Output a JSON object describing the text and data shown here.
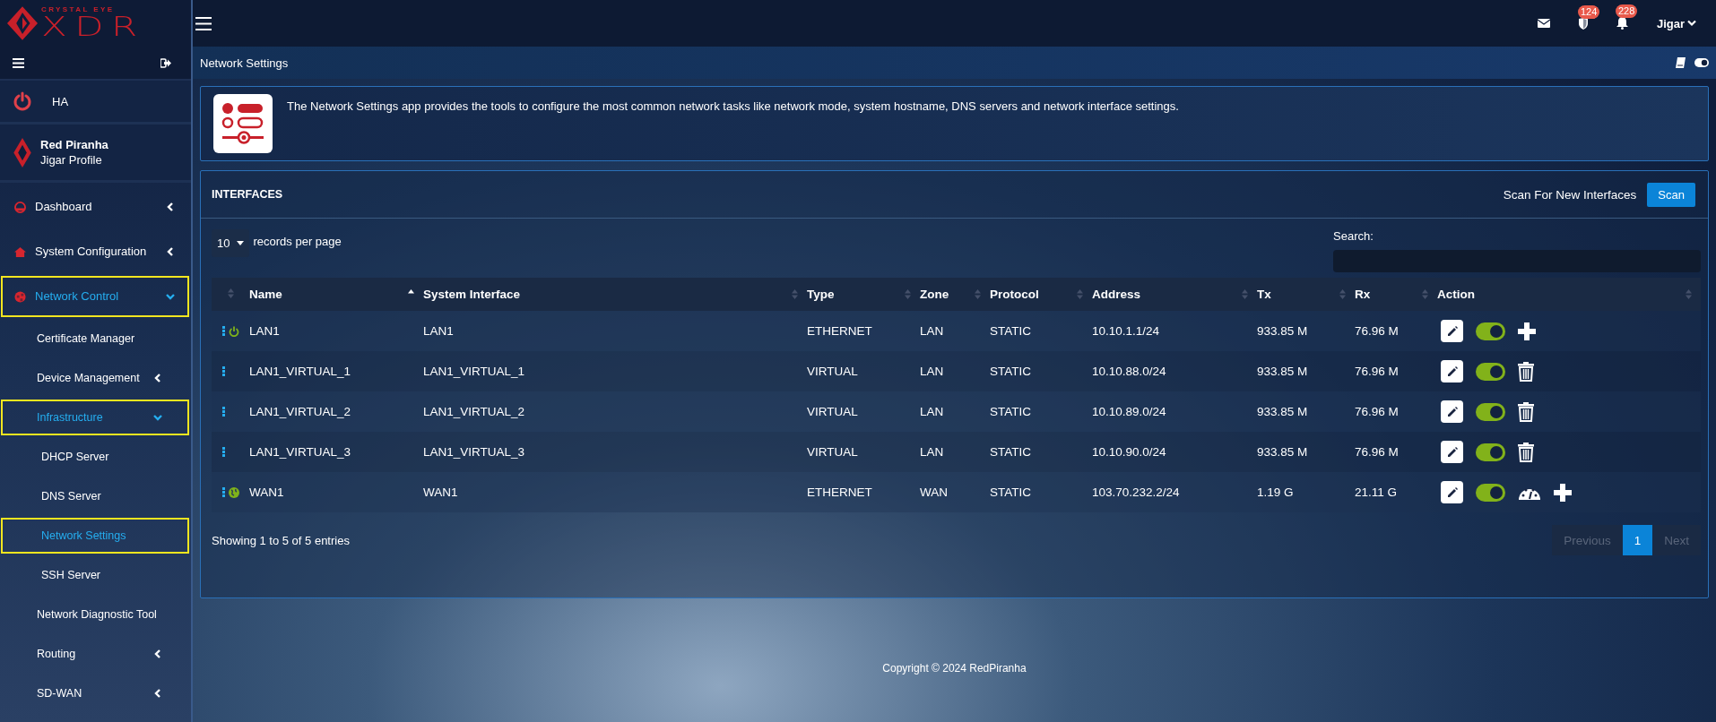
{
  "logo": {
    "tagline": "CRYSTAL EYE",
    "name": "XDR"
  },
  "topbar": {
    "badges": [
      {
        "kind": "shield",
        "count": "124"
      },
      {
        "kind": "bell",
        "count": "228"
      }
    ],
    "user": "Jigar"
  },
  "sidebar": {
    "ha": "HA",
    "profile": {
      "company": "Red Piranha",
      "name": "Jigar Profile"
    },
    "items": [
      {
        "label": "Dashboard",
        "kind": "gauge",
        "selected": false,
        "expanded": false
      },
      {
        "label": "System Configuration",
        "kind": "home",
        "selected": false,
        "expanded": false
      },
      {
        "label": "Network Control",
        "kind": "globe",
        "selected": true,
        "expanded": true,
        "children": [
          {
            "label": "Certificate Manager",
            "selected": false
          },
          {
            "label": "Device Management",
            "selected": false,
            "expanded": false
          },
          {
            "label": "Infrastructure",
            "selected": true,
            "expanded": true,
            "children": [
              {
                "label": "DHCP Server",
                "selected": false
              },
              {
                "label": "DNS Server",
                "selected": false
              },
              {
                "label": "Network Settings",
                "selected": true
              },
              {
                "label": "SSH Server",
                "selected": false
              }
            ]
          },
          {
            "label": "Network Diagnostic Tool",
            "selected": false
          },
          {
            "label": "Routing",
            "selected": false,
            "expanded": false
          },
          {
            "label": "SD-WAN",
            "selected": false,
            "expanded": false
          }
        ]
      }
    ]
  },
  "page_title": "Network Settings",
  "intro": "The Network Settings app provides the tools to configure the most common network tasks like network mode, system hostname, DNS servers and network interface settings.",
  "interfaces": {
    "title": "INTERFACES",
    "scan_label": "Scan For New Interfaces",
    "scan_button": "Scan",
    "page_size": "10",
    "page_size_label": "records per page",
    "search_label": "Search:",
    "columns": [
      {
        "label": "Name",
        "selected": true
      },
      {
        "label": "System Interface",
        "selected": false
      },
      {
        "label": "Type",
        "selected": false
      },
      {
        "label": "Zone",
        "selected": false
      },
      {
        "label": "Protocol",
        "selected": false
      },
      {
        "label": "Address",
        "selected": false
      },
      {
        "label": "Tx",
        "selected": false
      },
      {
        "label": "Rx",
        "selected": false
      },
      {
        "label": "Action",
        "selected": false
      }
    ],
    "rows": [
      {
        "kind": "power",
        "cells": [
          "LAN1",
          "LAN1",
          "ETHERNET",
          "LAN",
          "STATIC",
          "10.10.1.1/24",
          "933.85 M",
          "76.96 M"
        ],
        "on": true,
        "actions": [
          {
            "kind": "add"
          }
        ]
      },
      {
        "kind": "plain",
        "cells": [
          "LAN1_VIRTUAL_1",
          "LAN1_VIRTUAL_1",
          "VIRTUAL",
          "LAN",
          "STATIC",
          "10.10.88.0/24",
          "933.85 M",
          "76.96 M"
        ],
        "on": true,
        "actions": [
          {
            "kind": "delete"
          }
        ]
      },
      {
        "kind": "plain",
        "cells": [
          "LAN1_VIRTUAL_2",
          "LAN1_VIRTUAL_2",
          "VIRTUAL",
          "LAN",
          "STATIC",
          "10.10.89.0/24",
          "933.85 M",
          "76.96 M"
        ],
        "on": true,
        "actions": [
          {
            "kind": "delete"
          }
        ]
      },
      {
        "kind": "plain",
        "cells": [
          "LAN1_VIRTUAL_3",
          "LAN1_VIRTUAL_3",
          "VIRTUAL",
          "LAN",
          "STATIC",
          "10.10.90.0/24",
          "933.85 M",
          "76.96 M"
        ],
        "on": true,
        "actions": [
          {
            "kind": "delete"
          }
        ]
      },
      {
        "kind": "globe",
        "cells": [
          "WAN1",
          "WAN1",
          "ETHERNET",
          "WAN",
          "STATIC",
          "103.70.232.2/24",
          "1.19 G",
          "21.11 G"
        ],
        "on": true,
        "actions": [
          {
            "kind": "gauge"
          },
          {
            "kind": "add"
          }
        ]
      }
    ],
    "summary": "Showing 1 to 5 of 5 entries",
    "pagination": [
      {
        "label": "Previous",
        "disabled": true,
        "selected": false
      },
      {
        "label": "1",
        "disabled": false,
        "selected": true
      },
      {
        "label": "Next",
        "disabled": true,
        "selected": false
      }
    ]
  },
  "footer": "Copyright © 2024 RedPiranha"
}
